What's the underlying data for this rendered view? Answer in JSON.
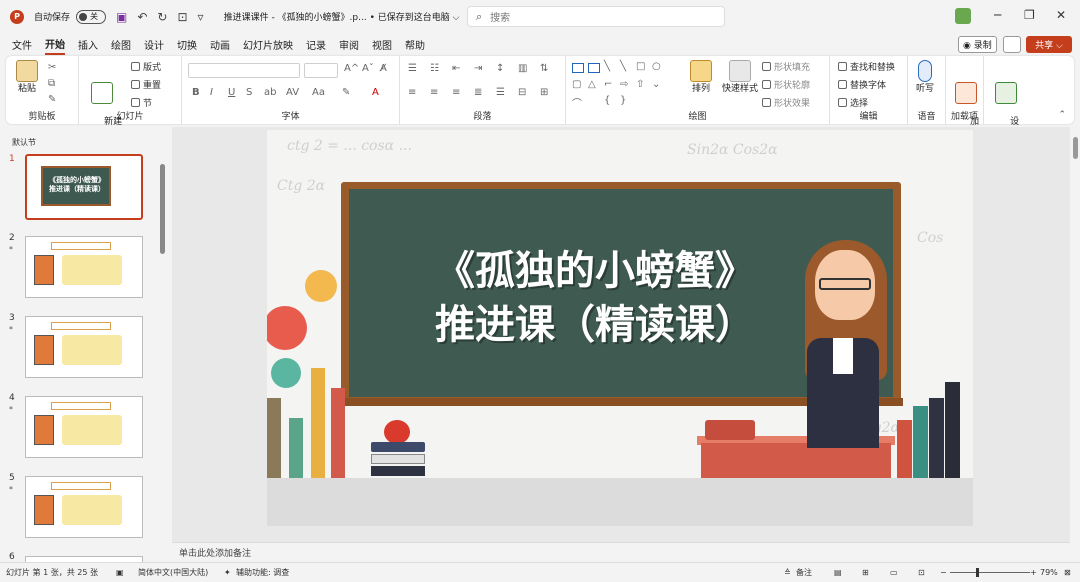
{
  "titlebar": {
    "autosave_label": "自动保存",
    "autosave_state": "关",
    "doc_title": "推进课课件 - 《孤独的小螃蟹》.p...  •  已保存到这台电脑 ⌵",
    "search_placeholder": "搜索"
  },
  "menu": {
    "tabs": [
      "文件",
      "开始",
      "插入",
      "绘图",
      "设计",
      "切换",
      "动画",
      "幻灯片放映",
      "记录",
      "审阅",
      "视图",
      "帮助"
    ],
    "active": "开始",
    "record_label": "◉ 录制",
    "share_label": "共享 ⌵"
  },
  "ribbon": {
    "clipboard": {
      "label": "剪贴板",
      "paste": "粘贴"
    },
    "slides": {
      "label": "幻灯片",
      "new_slide": "新建\n幻灯片",
      "layout": "版式",
      "reset": "重置",
      "section": "节"
    },
    "font": {
      "label": "字体"
    },
    "paragraph": {
      "label": "段落"
    },
    "drawing": {
      "label": "绘图",
      "arrange": "排列",
      "quick_styles": "快速样式",
      "fill": "形状填充",
      "outline": "形状轮廓",
      "effects": "形状效果"
    },
    "editing": {
      "label": "编辑",
      "find_replace": "查找和替换",
      "replace_font": "替换字体",
      "select": "选择"
    },
    "voice": {
      "label": "语音",
      "dictate": "听写"
    },
    "addins": {
      "label": "加载项",
      "addins_btn": "加\n载项"
    },
    "designer": {
      "label": "设\n计器"
    }
  },
  "thumbnails": {
    "section": "默认节",
    "items": [
      {
        "num": "1",
        "title": "《孤独的小螃蟹》\n推进课（精读课）"
      },
      {
        "num": "2"
      },
      {
        "num": "3"
      },
      {
        "num": "4"
      },
      {
        "num": "5"
      },
      {
        "num": "6"
      }
    ]
  },
  "slide": {
    "title_line1": "《孤独的小螃蟹》",
    "title_line2": "推进课（精读课）"
  },
  "notes": {
    "placeholder": "单击此处添加备注"
  },
  "status": {
    "slide_info": "幻灯片 第 1 张，共 25 张",
    "language": "简体中文(中国大陆)",
    "accessibility": "辅助功能: 调查",
    "notes_btn": "备注",
    "zoom": "79%"
  },
  "colors": {
    "accent": "#c43e1c",
    "board": "#3f5b51",
    "board_frame": "#9a5b2a"
  }
}
